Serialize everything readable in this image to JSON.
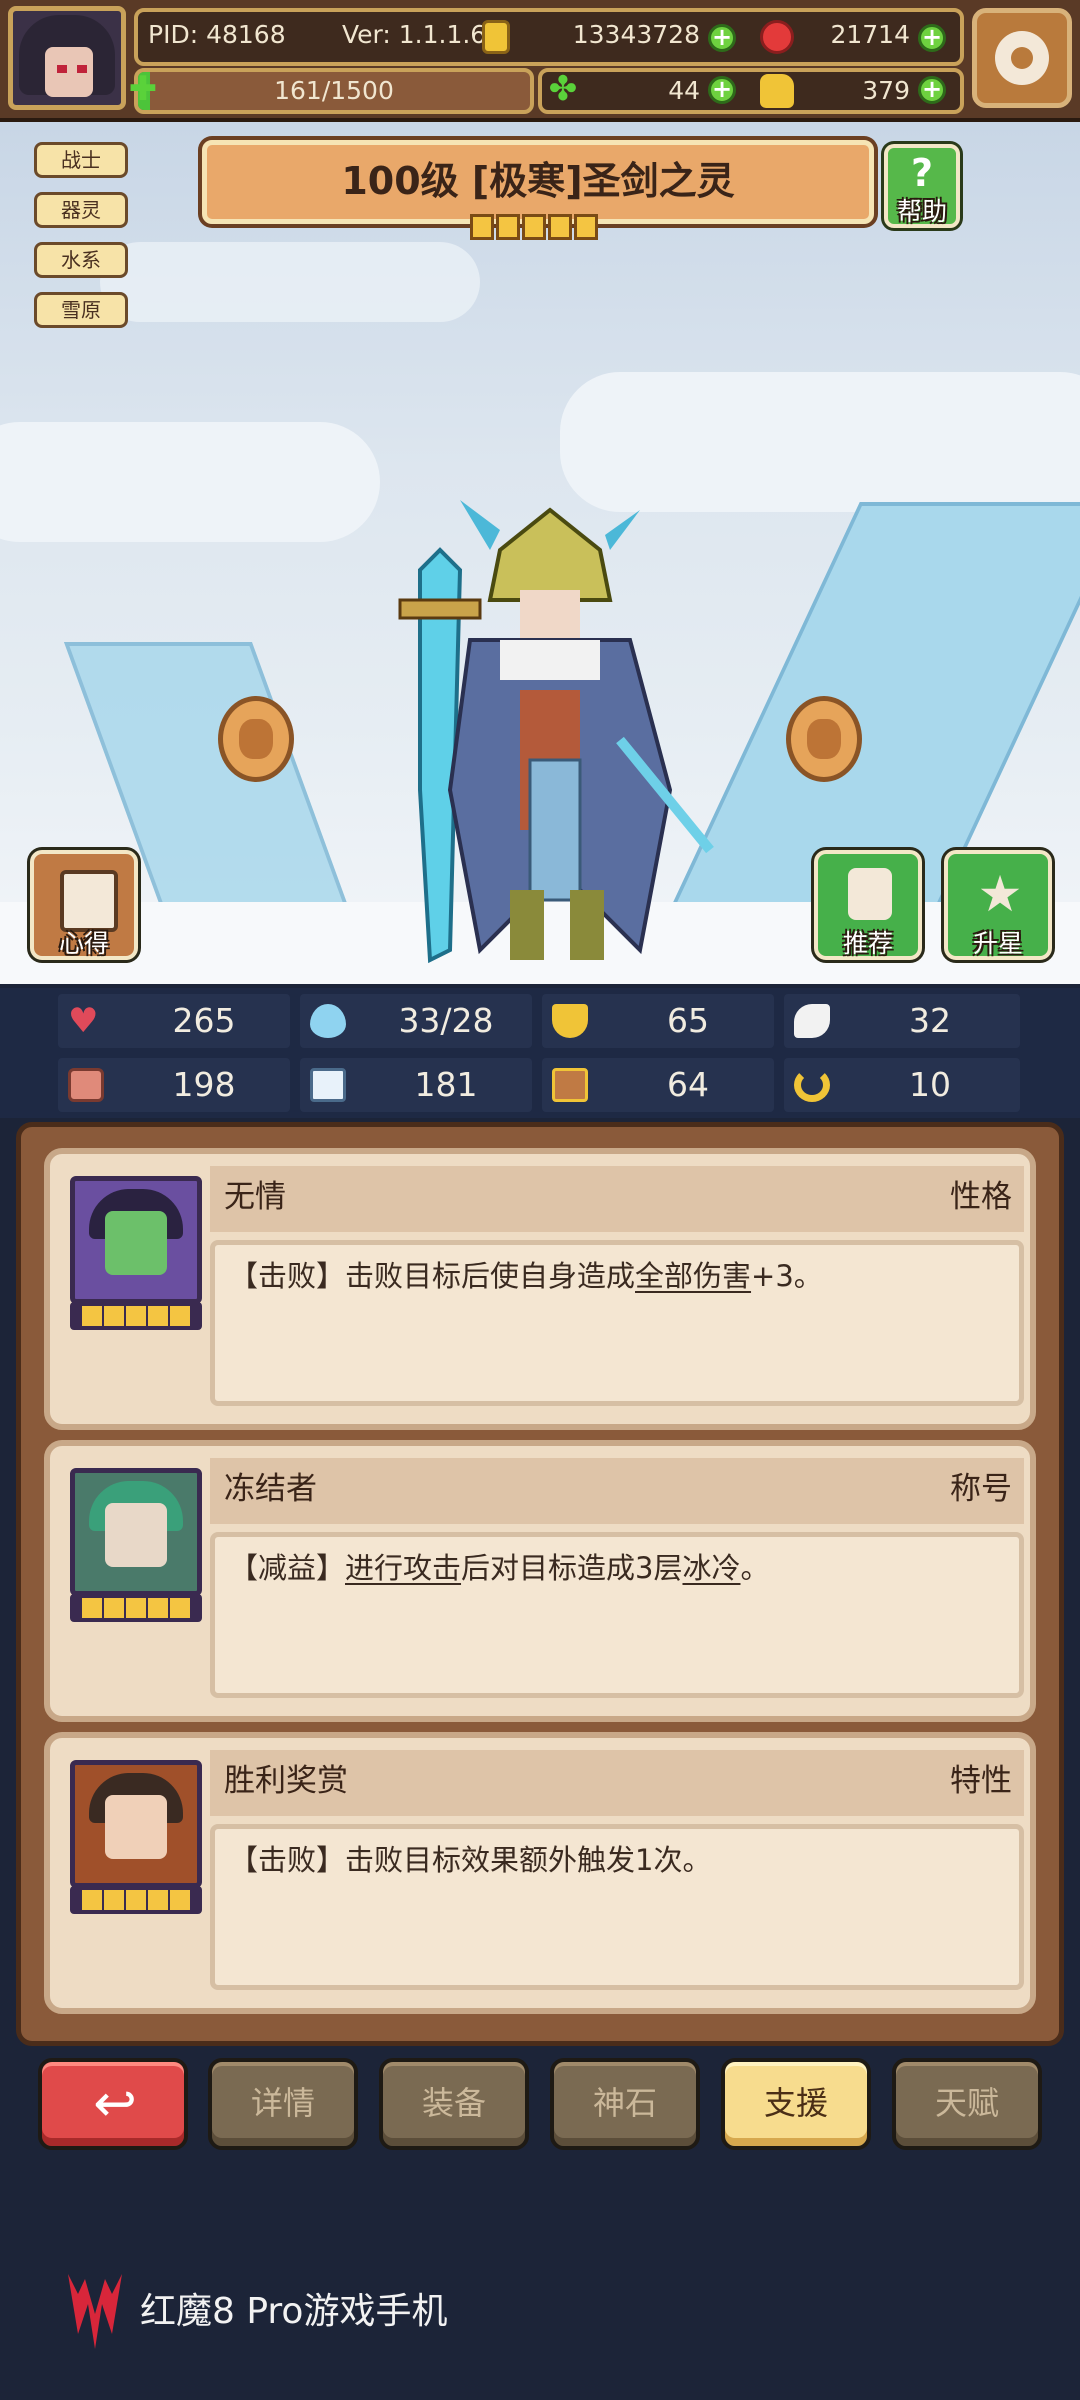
{
  "player": {
    "pid": "PID: 48168",
    "version": "Ver: 1.1.1.6",
    "exp": "161/1500",
    "gold": "13343728",
    "gems": "21714",
    "clover": "44",
    "fist": "379"
  },
  "tags": [
    "战士",
    "器灵",
    "水系",
    "雪原"
  ],
  "hero": {
    "title": "100级 [极寒]圣剑之灵",
    "stars": 5
  },
  "buttons": {
    "help": "帮助",
    "notes": "心得",
    "recommend": "推荐",
    "upstar": "升星"
  },
  "stats": [
    {
      "icon": "heart-icon",
      "value": "265"
    },
    {
      "icon": "water-drop-icon",
      "value": "33/28"
    },
    {
      "icon": "shield-icon",
      "value": "65"
    },
    {
      "icon": "wing-icon",
      "value": "32"
    },
    {
      "icon": "fist-icon",
      "value": "198"
    },
    {
      "icon": "book-icon",
      "value": "181"
    },
    {
      "icon": "boot-icon",
      "value": "64"
    },
    {
      "icon": "horseshoe-icon",
      "value": "10"
    }
  ],
  "cards": [
    {
      "name": "无情",
      "type": "性格",
      "desc_pre": "【击败】击败目标后使自身造成",
      "desc_link": "全部伤害",
      "desc_post": "+3。"
    },
    {
      "name": "冻结者",
      "type": "称号",
      "desc_pre": "【减益】",
      "desc_link": "进行攻击",
      "desc_mid": "后对目标造成3层",
      "desc_link2": "冰冷",
      "desc_post": "。"
    },
    {
      "name": "胜利奖赏",
      "type": "特性",
      "desc_pre": "【击败】击败目标效果额外触发1次。"
    }
  ],
  "tabs": [
    "详情",
    "装备",
    "神石",
    "支援",
    "天赋"
  ],
  "active_tab": "支援",
  "brand": "红魔8 Pro游戏手机",
  "colors": {
    "accent": "#f7dc8e",
    "panel": "#8a5a3a",
    "back": "#e04a4a",
    "plus": "#6ed13f"
  }
}
